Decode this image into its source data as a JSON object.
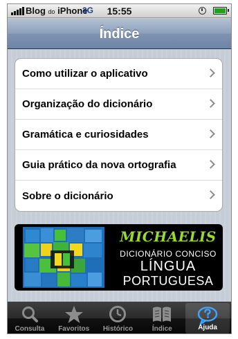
{
  "status_bar": {
    "carrier": "Blog",
    "carrier_small": "do",
    "carrier_rest": "iPhone",
    "network": "3G",
    "time": "15:55"
  },
  "nav": {
    "title": "Índice"
  },
  "menu": {
    "items": [
      {
        "label": "Como utilizar o aplicativo"
      },
      {
        "label": "Organização do dicionário"
      },
      {
        "label": "Gramática e curiosidades"
      },
      {
        "label": "Guia prático da nova ortografia"
      },
      {
        "label": "Sobre o dicionário"
      }
    ]
  },
  "banner": {
    "brand": "MICHAELIS",
    "subtitle": "DICIONÁRIO CONCISO",
    "line1": "LÍNGUA",
    "line2": "PORTUGUESA"
  },
  "tabs": [
    {
      "label": "Consulta",
      "icon": "magnifier-icon",
      "active": false
    },
    {
      "label": "Favoritos",
      "icon": "star-icon",
      "active": false
    },
    {
      "label": "Histórico",
      "icon": "clock-icon",
      "active": false
    },
    {
      "label": "Índice",
      "icon": "book-icon",
      "active": false
    },
    {
      "label": "Ajuda",
      "icon": "help-bubble-icon",
      "active": true
    }
  ],
  "colors": {
    "nav_blue": "#6d84a6",
    "brand_green": "#9ad832",
    "tab_active_icon": "#3fa3ff",
    "network_blue": "#1b3f8e"
  }
}
